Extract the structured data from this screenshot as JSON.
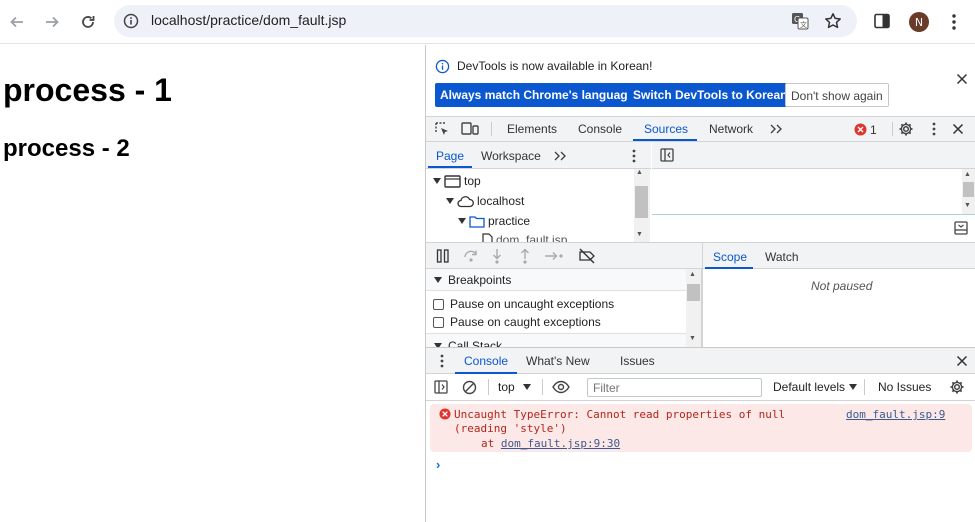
{
  "browser": {
    "url": "localhost/practice/dom_fault.jsp",
    "profile_initial": "N"
  },
  "page": {
    "heading1": "process - 1",
    "heading2": "process - 2"
  },
  "devtools": {
    "infobar": {
      "message": "DevTools is now available in Korean!",
      "btn_match": "Always match Chrome's language",
      "btn_switch": "Switch DevTools to Korean",
      "btn_dont_show": "Don't show again"
    },
    "tabs": [
      "Elements",
      "Console",
      "Sources",
      "Network"
    ],
    "selected_tab": "Sources",
    "error_count": "1",
    "navigator": {
      "tabs": [
        "Page",
        "Workspace"
      ],
      "tree": [
        "top",
        "localhost",
        "practice",
        "dom_fault.jsp"
      ]
    },
    "breakpoints": {
      "section_title": "Breakpoints",
      "items": [
        "Pause on uncaught exceptions",
        "Pause on caught exceptions"
      ],
      "next_section": "Call Stack"
    },
    "scope": {
      "tabs": [
        "Scope",
        "Watch"
      ],
      "status": "Not paused"
    },
    "drawer": {
      "tabs": [
        "Console",
        "What's New",
        "Issues"
      ]
    },
    "console_toolbar": {
      "context": "top",
      "filter_placeholder": "Filter",
      "levels": "Default levels",
      "issues": "No Issues"
    },
    "error": {
      "line1": "Uncaught TypeError: Cannot read properties of null",
      "line2": "(reading 'style')",
      "at_prefix": "at",
      "at_link": "dom_fault.jsp:9:30",
      "source_link": "dom_fault.jsp:9"
    }
  }
}
